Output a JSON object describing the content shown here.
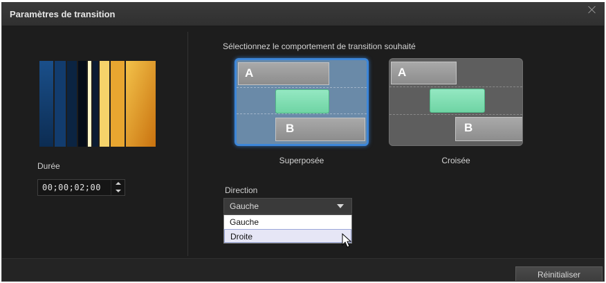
{
  "dialog": {
    "title": "Paramètres de transition"
  },
  "duration": {
    "label": "Durée",
    "value": "00;00;02;00"
  },
  "behavior": {
    "instruction": "Sélectionnez le comportement de transition souhaité",
    "options": [
      {
        "caption": "Superposée",
        "label_a": "A",
        "label_b": "B",
        "selected": true
      },
      {
        "caption": "Croisée",
        "label_a": "A",
        "label_b": "B",
        "selected": false
      }
    ]
  },
  "direction": {
    "label": "Direction",
    "selected": "Gauche",
    "options": [
      "Gauche",
      "Droite"
    ]
  },
  "footer": {
    "reset_label": "Réinitialiser"
  },
  "colors": {
    "accent": "#3d86d8",
    "selected_card": "#6a8aa8",
    "green_clip": "#7fdcb0"
  }
}
